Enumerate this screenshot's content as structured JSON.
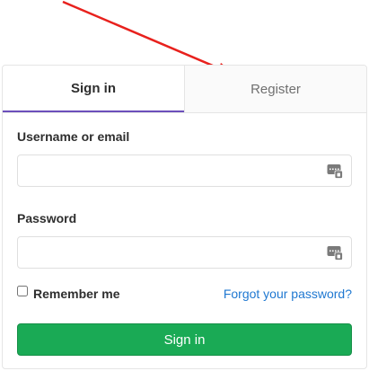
{
  "tabs": {
    "signin_label": "Sign in",
    "register_label": "Register"
  },
  "form": {
    "username_label": "Username or email",
    "username_value": "",
    "password_label": "Password",
    "password_value": "",
    "remember_label": "Remember me",
    "remember_checked": false,
    "forgot_label": "Forgot your password?",
    "submit_label": "Sign in"
  },
  "icons": {
    "field_icon": "password-manager-icon"
  },
  "colors": {
    "annotation_arrow": "#e8211d",
    "active_tab_underline": "#6b4fbb",
    "submit_button": "#1aaa55",
    "link": "#1f78d1"
  }
}
